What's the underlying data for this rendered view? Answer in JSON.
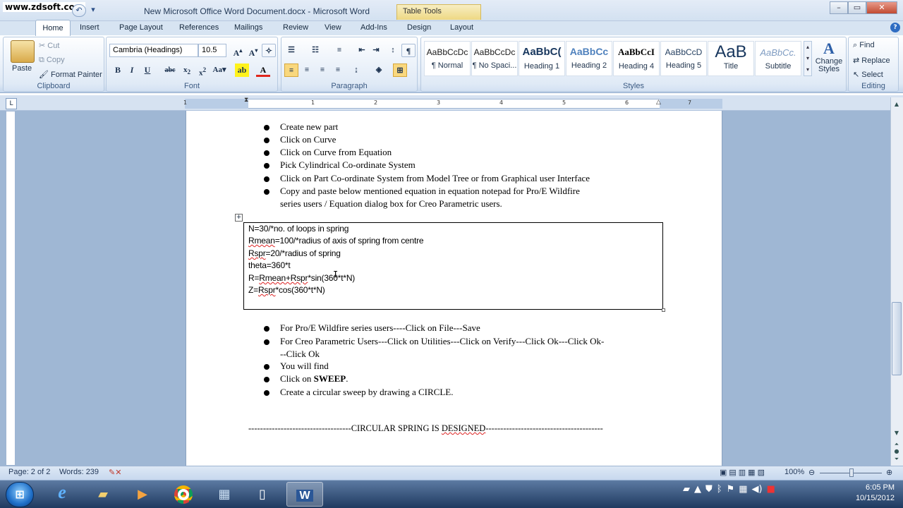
{
  "watermark": "www.zdsoft.com",
  "titlebar": {
    "title": "New Microsoft Office Word Document.docx - Microsoft Word",
    "context_tab": "Table Tools",
    "minimize": "–",
    "maximize": "▭",
    "close": "✕"
  },
  "tabs": [
    "Home",
    "Insert",
    "Page Layout",
    "References",
    "Mailings",
    "Review",
    "View",
    "Add-Ins",
    "Design",
    "Layout"
  ],
  "clipboard": {
    "paste": "Paste",
    "cut": "Cut",
    "copy": "Copy",
    "format_painter": "Format Painter",
    "label": "Clipboard"
  },
  "font": {
    "name": "Cambria (Headings)",
    "size": "10.5",
    "label": "Font"
  },
  "paragraph": {
    "label": "Paragraph"
  },
  "styles": {
    "label": "Styles",
    "items": [
      {
        "sample": "AaBbCcDc",
        "name": "¶ Normal"
      },
      {
        "sample": "AaBbCcDc",
        "name": "¶ No Spaci..."
      },
      {
        "sample": "AaBbC(",
        "name": "Heading 1"
      },
      {
        "sample": "AaBbCc",
        "name": "Heading 2"
      },
      {
        "sample": "AaBbCcI",
        "name": "Heading 4"
      },
      {
        "sample": "AaBbCcD",
        "name": "Heading 5"
      },
      {
        "sample": "AaB",
        "name": "Title"
      },
      {
        "sample": "AaBbCc.",
        "name": "Subtitle"
      }
    ],
    "change_styles": "Change Styles"
  },
  "editing": {
    "find": "Find",
    "replace": "Replace",
    "select": "Select",
    "label": "Editing"
  },
  "ruler": {
    "marks": [
      "1",
      "1",
      "2",
      "3",
      "4",
      "5",
      "6",
      "7"
    ]
  },
  "document": {
    "bullets_top": [
      "Create new part",
      "Click on Curve",
      "Click on Curve from Equation",
      "Pick Cylindrical Co-ordinate System",
      "Click on Part Co-ordinate System from Model Tree or from Graphical user Interface",
      "Copy and paste below mentioned equation in equation notepad for Pro/E Wildfire",
      "series users / Equation dialog box for Creo Parametric users."
    ],
    "code": {
      "l1": "N=30/*no. of loops in spring",
      "l2a": "Rmean",
      "l2b": "=100/*radius of axis of spring from centre",
      "l3a": "Rspr",
      "l3b": "=20/*radius of spring",
      "l4": "theta=360*t",
      "l5a": "R=",
      "l5b": "Rmean+Rspr",
      "l5c": "*sin(360*t*N)",
      "l6a": "Z=",
      "l6b": "Rspr",
      "l6c": "*cos(360*t*N)"
    },
    "bullets_bottom": [
      "For Pro/E Wildfire series users----Click on File---Save",
      "For Creo Parametric Users---Click on Utilities---Click  on Verify---Click Ok---Click  Ok-",
      "--Click Ok",
      "You will find",
      "Click on ",
      "SWEEP",
      ".",
      "Create a circular sweep by drawing a CIRCLE."
    ],
    "footer_a": "-----------------------------------CIRCULAR  SPRING IS ",
    "footer_b": "DESIGNED",
    "footer_c": "----------------------------------------"
  },
  "status": {
    "page": "Page: 2 of 2",
    "words": "Words: 239",
    "zoom": "100%"
  },
  "clock": {
    "time": "6:05 PM",
    "date": "10/15/2012"
  }
}
